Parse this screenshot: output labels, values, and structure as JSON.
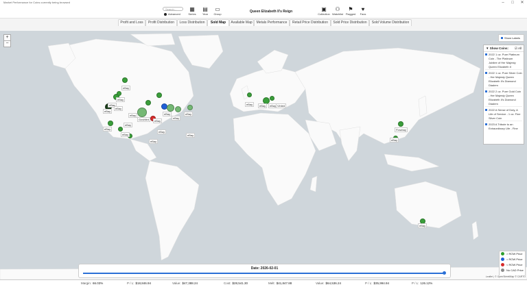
{
  "window": {
    "title": "Market Performance for Coins currently being browsed"
  },
  "toolbar": {
    "search_placeholder": "Search...",
    "advanced_label": "Advanced",
    "buttons": [
      {
        "label": "Series"
      },
      {
        "label": "Year"
      },
      {
        "label": "Group"
      }
    ],
    "center_title": "Queen Elizabeth II's Reign",
    "right_buttons": [
      {
        "label": "Collection"
      },
      {
        "label": "Watchlist"
      },
      {
        "label": "Flagged"
      },
      {
        "label": "Favs"
      }
    ]
  },
  "tabs": [
    {
      "label": "Profit and Loss"
    },
    {
      "label": "Profit Distribution"
    },
    {
      "label": "Loss Distribution"
    },
    {
      "label": "Sold Map"
    },
    {
      "label": "Available Map"
    },
    {
      "label": "Metals Performance"
    },
    {
      "label": "Retail Price Distribution"
    },
    {
      "label": "Sold Price Distribution"
    },
    {
      "label": "Sold Volume Distribution"
    }
  ],
  "map": {
    "show_labels": "Show Labels",
    "labels": [
      "eBay",
      "eBay",
      "eBay",
      "eBay",
      "eBay",
      "eBay",
      "eBay",
      "eBay",
      "eBay",
      "eBay",
      "eBay",
      "eBay",
      "eBay",
      "eBay",
      "eBay",
      "eBay",
      "eBay",
      "eBay",
      "eBay",
      "eBay",
      "eBay",
      "eBay",
      "eBay",
      "eBay",
      "eBay",
      "eBay",
      "eBay",
      "eBay",
      "eBay",
      "eBay",
      "eBay",
      "eBay",
      "eBay",
      "eBay",
      "eBay",
      "eBay",
      "eBay",
      "eBay",
      "eBay",
      "eBay",
      "eBay",
      "eBay",
      "eBay",
      "eBay",
      "GovMint",
      "Vinted",
      "Flowbay"
    ],
    "attribution": "Leaflet | © OpenStreetMap © CARTO"
  },
  "coin_panel": {
    "title": "Show Coins:",
    "all_label": "All",
    "items": [
      "2022 1 oz. Pure Platinum Coin - The Platinum Jubilee of Her Majesty Queen Elizabeth II",
      "2022 1 oz. Pure Silver Coin - Her Majesty Queen Elizabeth II's Diamond Diadem",
      "2022 2 oz. Pure Gold Coin - Her Majesty Queen Elizabeth II's Diamond Diadem",
      "2022 A Sense of Duty, A Life of Service - 1 oz. Fine Silver Coin",
      "2023 A Tribute to an Extraordinary Life - Fine"
    ]
  },
  "legend": [
    {
      "label": "> ROW Price",
      "color": "#2e9e2e"
    },
    {
      "label": "= ROW Price",
      "color": "#1f5fd6"
    },
    {
      "label": "< ROW Price",
      "color": "#d62b2b"
    },
    {
      "label": "No CAD Price",
      "color": "#8a8a8a"
    }
  ],
  "date_slider": {
    "label": "Date: 2026-02-01",
    "position": 1.0
  },
  "status": {
    "margin_label": "Margin:",
    "margin": "66.03%",
    "pl_label": "P / L:",
    "pl": "$18,846.94",
    "value_label": "Value:",
    "value": "$47,388.24",
    "cost_label": "Cost:",
    "cost": "$28,541.30",
    "melt_label": "Melt:",
    "melt": "$41,847.88",
    "value2_label": "Value:",
    "value2": "$64,536.24",
    "pl2_label": "P / L:",
    "pl2": "$35,994.94",
    "pct_label": "P / L:",
    "pct": "126.12%"
  }
}
